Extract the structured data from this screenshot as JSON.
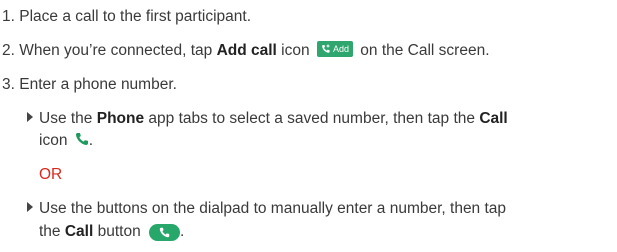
{
  "steps": [
    {
      "num": "1.",
      "text": "Place a call to the first participant."
    },
    {
      "num": "2.",
      "pre": "When you’re connected, tap ",
      "bold": "Add call",
      "mid": " icon",
      "icon_label": "Add",
      "post": " on the Call screen."
    },
    {
      "num": "3.",
      "text": "Enter a phone number."
    }
  ],
  "bullets": [
    {
      "line1_pre": "Use the ",
      "line1_bold1": "Phone",
      "line1_mid": " app tabs to select a saved number, then tap the ",
      "line1_bold2": "Call",
      "line2_text": "icon",
      "line2_end": "."
    },
    {
      "line1": "Use the buttons on the dialpad to manually enter a number, then tap",
      "line2_pre": "the ",
      "line2_bold": "Call",
      "line2_mid": " button",
      "line2_end": "."
    }
  ],
  "or_label": "OR",
  "colors": {
    "accent_green": "#2fa66e",
    "or_red": "#d9281e"
  }
}
